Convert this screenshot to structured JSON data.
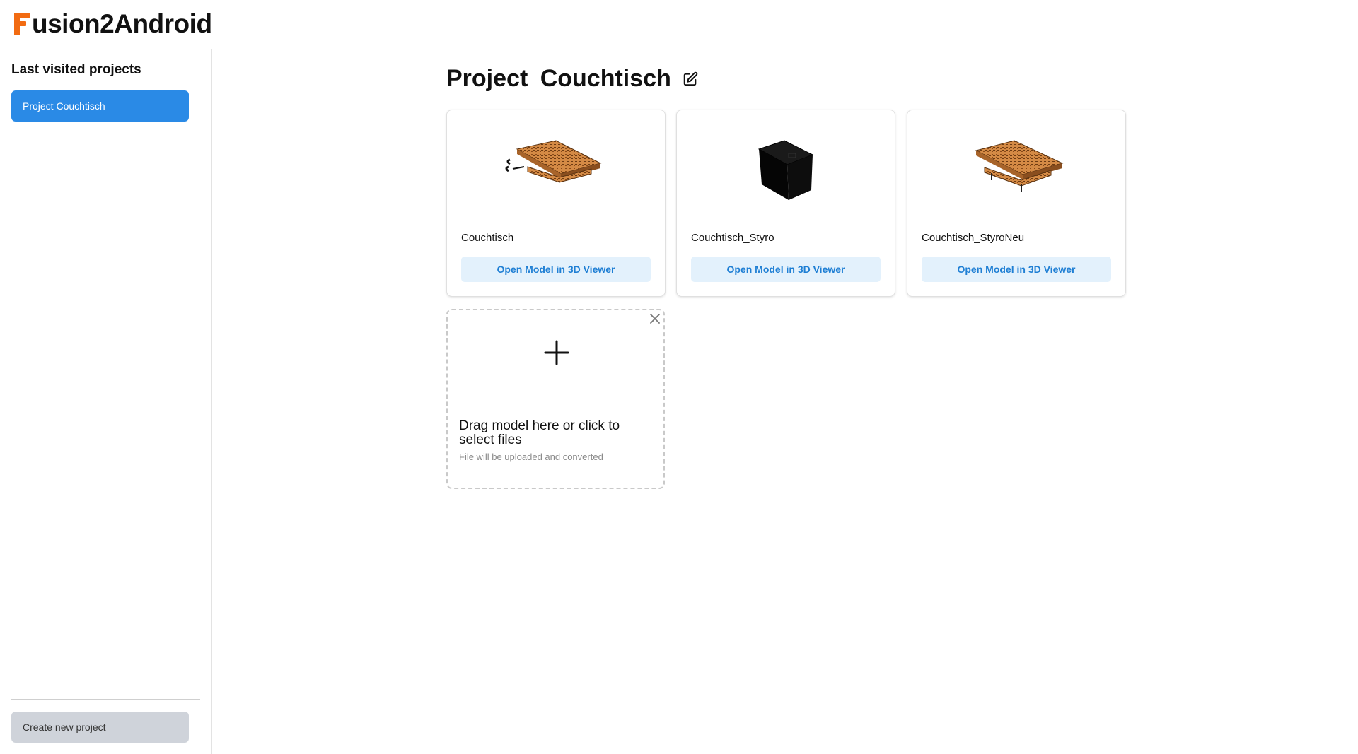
{
  "app": {
    "logo_text": "usion2Android",
    "brand_color": "#f26b12"
  },
  "sidebar": {
    "title": "Last visited projects",
    "items": [
      {
        "label": "Project Couchtisch",
        "active": true
      }
    ],
    "create_button_label": "Create new project"
  },
  "main": {
    "title": "Project Couchtisch",
    "edit_icon": "pencil-square-icon",
    "models": [
      {
        "name": "Couchtisch",
        "button_label": "Open Model in 3D Viewer",
        "thumbnail": "wooden-table-icon"
      },
      {
        "name": "Couchtisch_Styro",
        "button_label": "Open Model in 3D Viewer",
        "thumbnail": "black-box-icon"
      },
      {
        "name": "Couchtisch_StyroNeu",
        "button_label": "Open Model in 3D Viewer",
        "thumbnail": "wooden-table-icon"
      }
    ],
    "upload": {
      "title": "Drag model here or click to select files",
      "subtitle": "File will be uploaded and converted",
      "plus_icon": "plus-icon",
      "close_icon": "close-icon"
    }
  },
  "colors": {
    "accent": "#2a8ae6",
    "button_bg": "#e3f1fc",
    "button_text": "#1f7fd4",
    "secondary_button_bg": "#cfd3da"
  }
}
